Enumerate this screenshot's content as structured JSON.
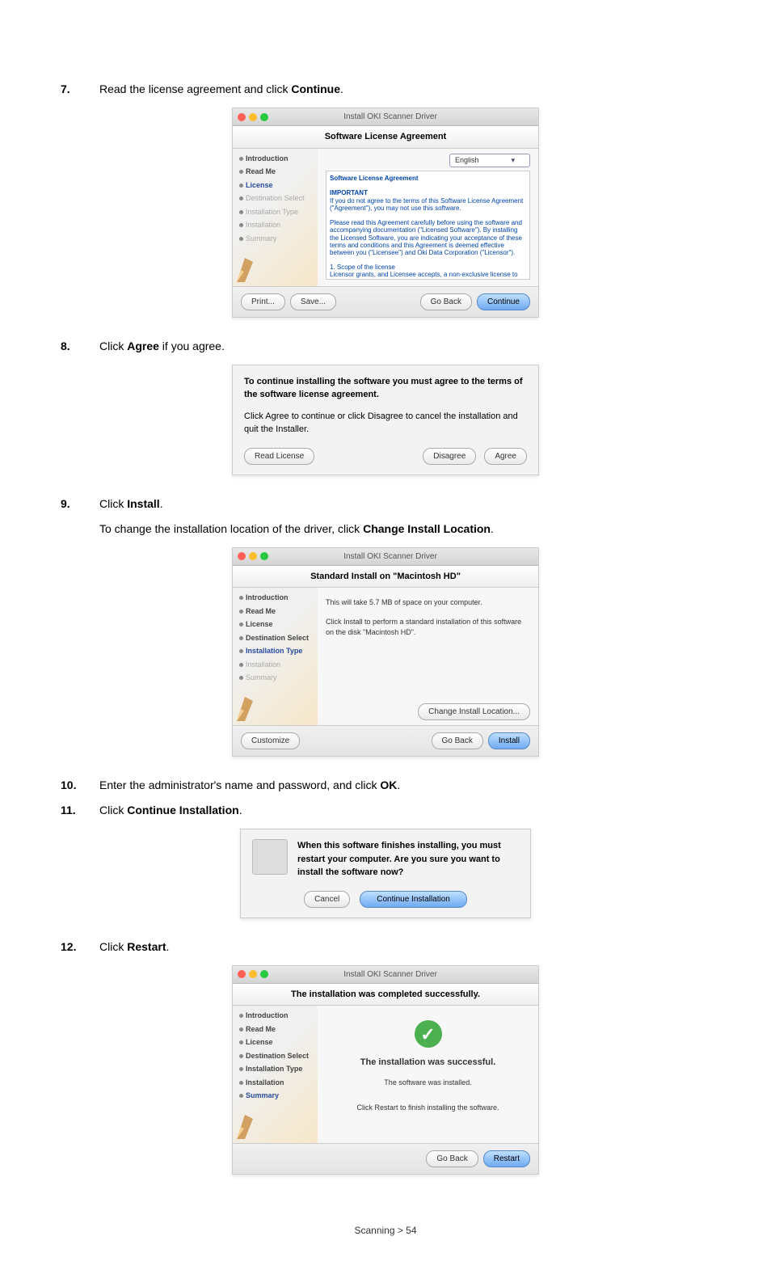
{
  "steps": {
    "s7": {
      "num": "7.",
      "text_before": "Read the license agreement and click ",
      "bold": "Continue",
      "after": "."
    },
    "s8": {
      "num": "8.",
      "text_before": "Click ",
      "bold": "Agree",
      "after": " if you agree."
    },
    "s9": {
      "num": "9.",
      "text_before": "Click ",
      "bold": "Install",
      "after": ".",
      "sub_before": "To change the installation location of the driver, click ",
      "sub_bold": "Change Install Location",
      "sub_after": "."
    },
    "s10": {
      "num": "10.",
      "text_before": "Enter the administrator's name and password, and click ",
      "bold": "OK",
      "after": "."
    },
    "s11": {
      "num": "11.",
      "text_before": "Click ",
      "bold": "Continue Installation",
      "after": "."
    },
    "s12": {
      "num": "12.",
      "text_before": "Click ",
      "bold": "Restart",
      "after": "."
    }
  },
  "installer": {
    "title": "Install OKI Scanner Driver",
    "sub_license": "Software License Agreement",
    "sub_standard": "Standard Install on \"Macintosh HD\"",
    "sub_complete": "The installation was completed successfully.",
    "sidebar": [
      "Introduction",
      "Read Me",
      "License",
      "Destination Select",
      "Installation Type",
      "Installation",
      "Summary"
    ],
    "lang": "English",
    "lic_head": "Software License Agreement",
    "lic_imp": "IMPORTANT",
    "lic_p1": "If you do not agree to the terms of this Software License Agreement (\"Agreement\"), you may not use this software.",
    "lic_p2": "Please read this Agreement carefully before using the software and accompanying documentation (\"Licensed Software\"). By installing the Licensed Software, you are indicating your acceptance of these terms and conditions and this Agreement is deemed effective between you (\"Licensee\") and Oki Data Corporation (\"Licensor\").",
    "lic_p3h": "1. Scope of the license",
    "lic_p3": "Licensor grants, and Licensee accepts, a non-exclusive license to install the Licensed Software on multiple computers which are directly or through network connected to Licensor's printer product or MFP purchased by Licensee (\"Product\") and to use the Licensed Software solely in conjunction with Product. Licensee may make one copy of the Licensed Software only for backup purpose. Any copies of the Licensed Software that Licensee is permitted to make herein must contain the same copyright and other proprietary notices that appear",
    "std_p1": "This will take 5.7 MB of space on your computer.",
    "std_p2": "Click Install to perform a standard installation of this software on the disk \"Macintosh HD\".",
    "succ_h": "The installation was successful.",
    "succ_p": "The software was installed.",
    "succ_p2": "Click Restart to finish installing the software.",
    "btn": {
      "print": "Print...",
      "save": "Save...",
      "goback": "Go Back",
      "continue": "Continue",
      "customize": "Customize",
      "install": "Install",
      "change": "Change Install Location...",
      "restart": "Restart"
    }
  },
  "agree": {
    "head": "To continue installing the software you must agree to the terms of the software license agreement.",
    "body": "Click Agree to continue or click Disagree to cancel the installation and quit the Installer.",
    "read": "Read License",
    "disagree": "Disagree",
    "agree": "Agree"
  },
  "ci": {
    "text": "When this software finishes installing, you must restart your computer. Are you sure you want to install the software now?",
    "cancel": "Cancel",
    "cont": "Continue Installation"
  },
  "footer": "Scanning > 54"
}
